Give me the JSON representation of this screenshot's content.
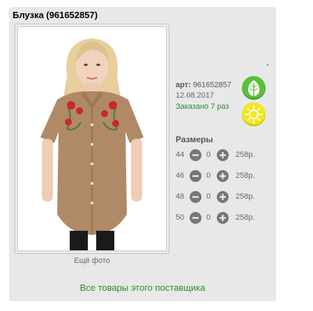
{
  "product": {
    "title": "Блузка (961652857)",
    "more_photo": "Ещё фото",
    "art_label": "арт:",
    "art_value": "961652857",
    "date": "12.08.2017",
    "ordered": "Заказано 7 раз"
  },
  "sizes": {
    "title": "Размеры",
    "rows": [
      {
        "size": "44",
        "qty": "0",
        "price": "258р."
      },
      {
        "size": "46",
        "qty": "0",
        "price": "258р."
      },
      {
        "size": "48",
        "qty": "0",
        "price": "258р."
      },
      {
        "size": "50",
        "qty": "0",
        "price": "258р."
      }
    ]
  },
  "supplier_link": "Все товары этого поставщика",
  "colors": {
    "link_green": "#2c8a2c",
    "leaf_badge": "#5cbf3a",
    "sun_badge": "#f3e619",
    "card_bg": "#e8e8e8",
    "blouse": "#b08a66"
  },
  "icons": {
    "leaf_badge": "leaf-icon",
    "sun_badge": "sun-icon",
    "minus": "minus-circle-icon",
    "plus": "plus-circle-icon"
  }
}
